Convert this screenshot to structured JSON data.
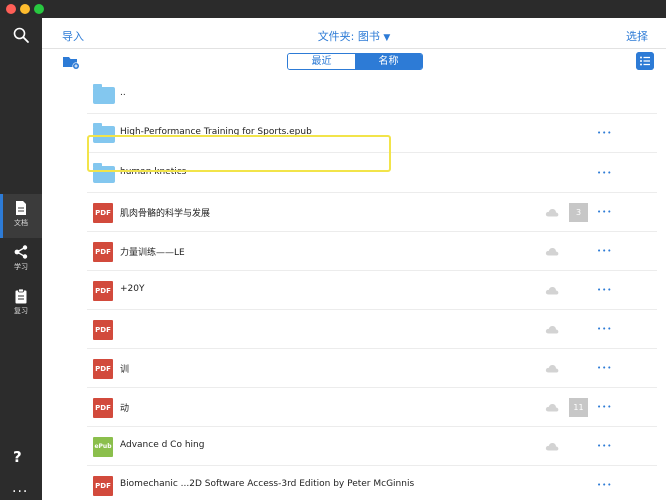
{
  "sidebar": {
    "items": [
      {
        "label": "文档",
        "icon": "document-icon",
        "active": true
      },
      {
        "label": "学习",
        "icon": "share-nodes-icon",
        "active": false
      },
      {
        "label": "复习",
        "icon": "clipboard-icon",
        "active": false
      }
    ],
    "help_label": "?",
    "more_label": "..."
  },
  "header": {
    "import_label": "导入",
    "folder_title": "文件夹: 图书",
    "folder_arrow": "▼",
    "select_label": "选择"
  },
  "toolbar": {
    "segment": [
      {
        "label": "最近",
        "selected": false
      },
      {
        "label": "名称",
        "selected": true
      }
    ]
  },
  "list": {
    "items": [
      {
        "type": "folder",
        "name": "..",
        "cloud": false,
        "badge": "",
        "more": false
      },
      {
        "type": "folder",
        "name": "High-Performance Training for Sports.epub",
        "cloud": false,
        "badge": "",
        "more": true
      },
      {
        "type": "folder",
        "name": "human knetics",
        "cloud": false,
        "badge": "",
        "more": true
      },
      {
        "type": "pdf",
        "name": "肌肉骨骼的科学与发展",
        "cloud": true,
        "badge": "3",
        "more": true
      },
      {
        "type": "pdf",
        "name": "力量训练——LE",
        "cloud": true,
        "badge": "",
        "more": true
      },
      {
        "type": "pdf",
        "name": "+20Y",
        "cloud": true,
        "badge": "",
        "more": true
      },
      {
        "type": "pdf",
        "name": "",
        "cloud": true,
        "badge": "",
        "more": true
      },
      {
        "type": "pdf",
        "name": "训",
        "cloud": true,
        "badge": "",
        "more": true
      },
      {
        "type": "pdf",
        "name": "动",
        "cloud": true,
        "badge": "11",
        "more": true
      },
      {
        "type": "epub",
        "name": "Advance    d Co    hing",
        "cloud": true,
        "badge": "",
        "more": true
      },
      {
        "type": "pdf",
        "name": "Biomechanic    ...2D Software Access-3rd Edition by Peter McGinnis",
        "cloud": false,
        "badge": "",
        "more": true
      }
    ]
  },
  "icons": {
    "pdf_label": "PDF",
    "epub_label": "ePub"
  },
  "colors": {
    "accent": "#2d7bd6",
    "highlight": "#f2e44a",
    "pdf": "#d24a3c",
    "epub": "#8bbf4c",
    "folder": "#83c7ef"
  }
}
